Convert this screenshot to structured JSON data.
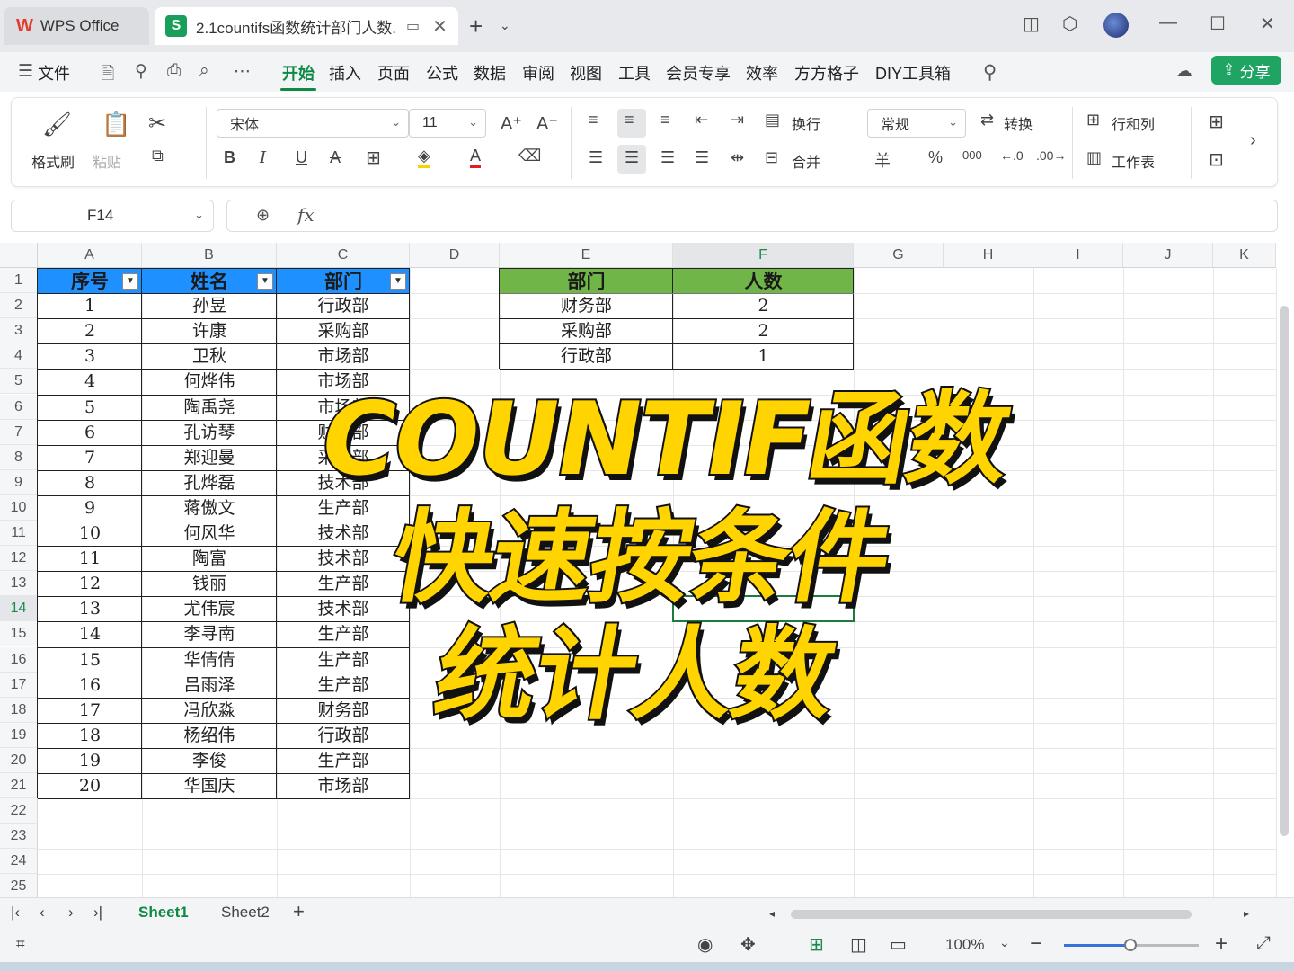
{
  "titlebar": {
    "home_tab": "WPS Office",
    "doc_tab": "2.1countifs函数统计部门人数.",
    "doc_icon": "S"
  },
  "menu": {
    "file": "文件",
    "tabs": [
      "开始",
      "插入",
      "页面",
      "公式",
      "数据",
      "审阅",
      "视图",
      "工具",
      "会员专享",
      "效率",
      "方方格子",
      "DIY工具箱"
    ],
    "active_tab": "开始",
    "share": "分享"
  },
  "ribbon": {
    "format_painter": "格式刷",
    "paste": "粘贴",
    "font_name": "宋体",
    "font_size": "11",
    "wrap": "换行",
    "merge": "合并",
    "number_format": "常规",
    "convert": "转换",
    "rows_cols": "行和列",
    "worksheet": "工作表",
    "currency_symbol": "羊",
    "percent_symbol": "%",
    "thousands_symbol": "000"
  },
  "formula_bar": {
    "name_box": "F14",
    "formula": ""
  },
  "sheet": {
    "columns": [
      "A",
      "B",
      "C",
      "D",
      "E",
      "F",
      "G",
      "H",
      "I",
      "J",
      "K"
    ],
    "selected_column": "F",
    "rows": [
      "1",
      "2",
      "3",
      "4",
      "5",
      "6",
      "7",
      "8",
      "9",
      "10",
      "11",
      "12",
      "13",
      "14",
      "15",
      "16",
      "17",
      "18",
      "19",
      "20",
      "21",
      "22",
      "23",
      "24",
      "25"
    ],
    "selected_row": "14",
    "table1": {
      "headers": [
        "序号",
        "姓名",
        "部门"
      ],
      "rows": [
        [
          "1",
          "孙昱",
          "行政部"
        ],
        [
          "2",
          "许康",
          "采购部"
        ],
        [
          "3",
          "卫秋",
          "市场部"
        ],
        [
          "4",
          "何烨伟",
          "市场部"
        ],
        [
          "5",
          "陶禹尧",
          "市场部"
        ],
        [
          "6",
          "孔访琴",
          "财务部"
        ],
        [
          "7",
          "郑迎曼",
          "采购部"
        ],
        [
          "8",
          "孔烨磊",
          "技术部"
        ],
        [
          "9",
          "蒋傲文",
          "生产部"
        ],
        [
          "10",
          "何风华",
          "技术部"
        ],
        [
          "11",
          "陶富",
          "技术部"
        ],
        [
          "12",
          "钱丽",
          "生产部"
        ],
        [
          "13",
          "尤伟宸",
          "技术部"
        ],
        [
          "14",
          "李寻南",
          "生产部"
        ],
        [
          "15",
          "华倩倩",
          "生产部"
        ],
        [
          "16",
          "吕雨泽",
          "生产部"
        ],
        [
          "17",
          "冯欣淼",
          "财务部"
        ],
        [
          "18",
          "杨绍伟",
          "行政部"
        ],
        [
          "19",
          "李俊",
          "生产部"
        ],
        [
          "20",
          "华国庆",
          "市场部"
        ]
      ],
      "header_color": "#1e90ff"
    },
    "table2": {
      "headers": [
        "部门",
        "人数"
      ],
      "rows": [
        [
          "财务部",
          "2"
        ],
        [
          "采购部",
          "2"
        ],
        [
          "行政部",
          "1"
        ]
      ],
      "header_color": "#6fb548"
    }
  },
  "overlay": {
    "line1": "COUNTIF函数",
    "line2": "快速按条件",
    "line3": "统计人数",
    "color": "#ffd400"
  },
  "sheet_tabs": {
    "tabs": [
      "Sheet1",
      "Sheet2"
    ],
    "active": "Sheet1"
  },
  "status": {
    "zoom": "100%",
    "zoom_fraction": 0.5
  }
}
